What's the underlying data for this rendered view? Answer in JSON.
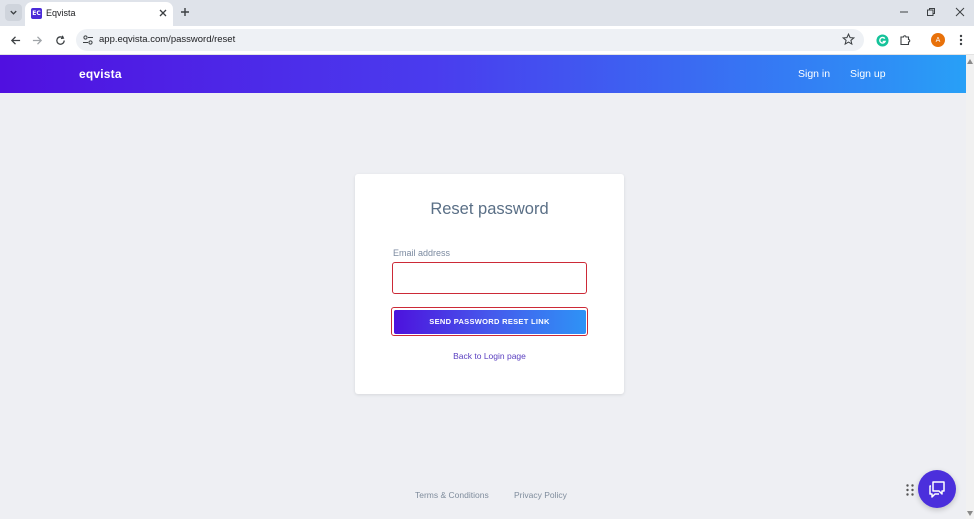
{
  "browser": {
    "tab_title": "Eqvista",
    "favicon_text": "EC",
    "url": "app.eqvista.com/password/reset",
    "profile_initial": "A"
  },
  "header": {
    "brand": "eqvista",
    "sign_in": "Sign in",
    "sign_up": "Sign up"
  },
  "form": {
    "title": "Reset password",
    "email_label": "Email address",
    "email_value": "",
    "submit_label": "SEND PASSWORD RESET LINK",
    "back_link": "Back to Login page"
  },
  "footer": {
    "terms": "Terms & Conditions",
    "privacy": "Privacy Policy"
  },
  "colors": {
    "brand_purple": "#5010e0",
    "brand_blue": "#28a0f7",
    "error_border": "#cc2a37"
  }
}
